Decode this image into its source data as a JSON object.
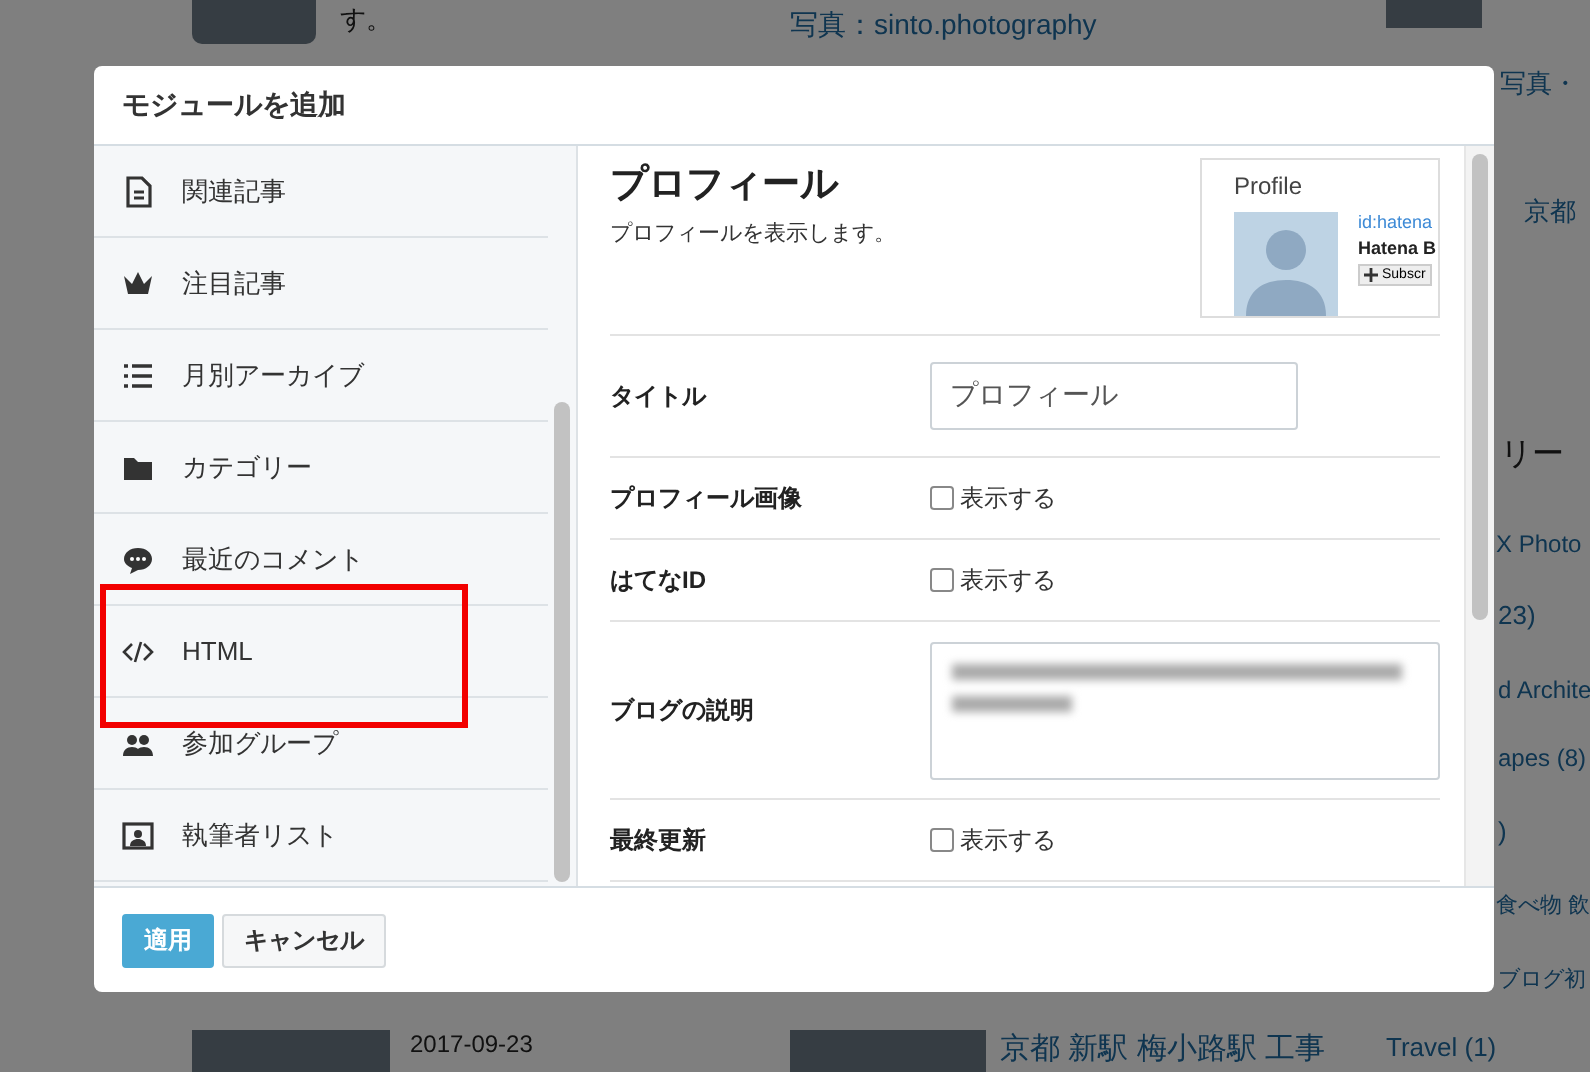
{
  "background": [
    {
      "kind": "photo"
    },
    {
      "kind": "text",
      "text": "す。"
    },
    {
      "kind": "link",
      "text": "写真：sinto.photography"
    },
    {
      "kind": "photo"
    },
    {
      "kind": "link",
      "text": "写真・"
    },
    {
      "kind": "link",
      "text": "京都"
    },
    {
      "kind": "heading",
      "text": "リー"
    },
    {
      "kind": "link",
      "text": "X Photo"
    },
    {
      "kind": "link",
      "text": "23)"
    },
    {
      "kind": "link",
      "text": "d Archite"
    },
    {
      "kind": "link",
      "text": "apes (8)"
    },
    {
      "kind": "link",
      "text": ")"
    },
    {
      "kind": "link",
      "text": "食べ物 飲"
    },
    {
      "kind": "link",
      "text": "ブログ初"
    },
    {
      "kind": "photo"
    },
    {
      "kind": "text",
      "text": "2017-09-23"
    },
    {
      "kind": "photo"
    },
    {
      "kind": "link",
      "text": "京都 新駅 梅小路駅 工事"
    },
    {
      "kind": "link",
      "text": "Travel (1)"
    }
  ],
  "modal": {
    "title": "モジュールを追加",
    "modules": [
      {
        "label": "関連記事",
        "selected": false,
        "highlighted": false
      },
      {
        "label": "注目記事",
        "selected": false,
        "highlighted": false
      },
      {
        "label": "月別アーカイブ",
        "selected": false,
        "highlighted": false
      },
      {
        "label": "カテゴリー",
        "selected": false,
        "highlighted": false
      },
      {
        "label": "最近のコメント",
        "selected": false,
        "highlighted": false
      },
      {
        "label": "HTML",
        "selected": false,
        "highlighted": true
      },
      {
        "label": "参加グループ",
        "selected": false,
        "highlighted": false
      },
      {
        "label": "執筆者リスト",
        "selected": false,
        "highlighted": false
      }
    ],
    "detail": {
      "title": "プロフィール",
      "description": "プロフィールを表示します。",
      "preview": {
        "heading": "Profile",
        "id": "id:hatena",
        "name": "Hatena B",
        "button": "Subscr"
      },
      "fields": [
        {
          "kind": "text",
          "label": "タイトル",
          "value": "プロフィール"
        },
        {
          "kind": "checkbox",
          "label": "プロフィール画像",
          "option": "表示する",
          "checked": false
        },
        {
          "kind": "checkbox",
          "label": "はてなID",
          "option": "表示する",
          "checked": false
        },
        {
          "kind": "textarea",
          "label": "ブログの説明"
        },
        {
          "kind": "checkbox",
          "label": "最終更新",
          "option": "表示する",
          "checked": false
        }
      ]
    },
    "buttons": [
      {
        "label": "適用",
        "kind": "primary"
      },
      {
        "label": "キャンセル",
        "kind": "secondary"
      }
    ]
  }
}
